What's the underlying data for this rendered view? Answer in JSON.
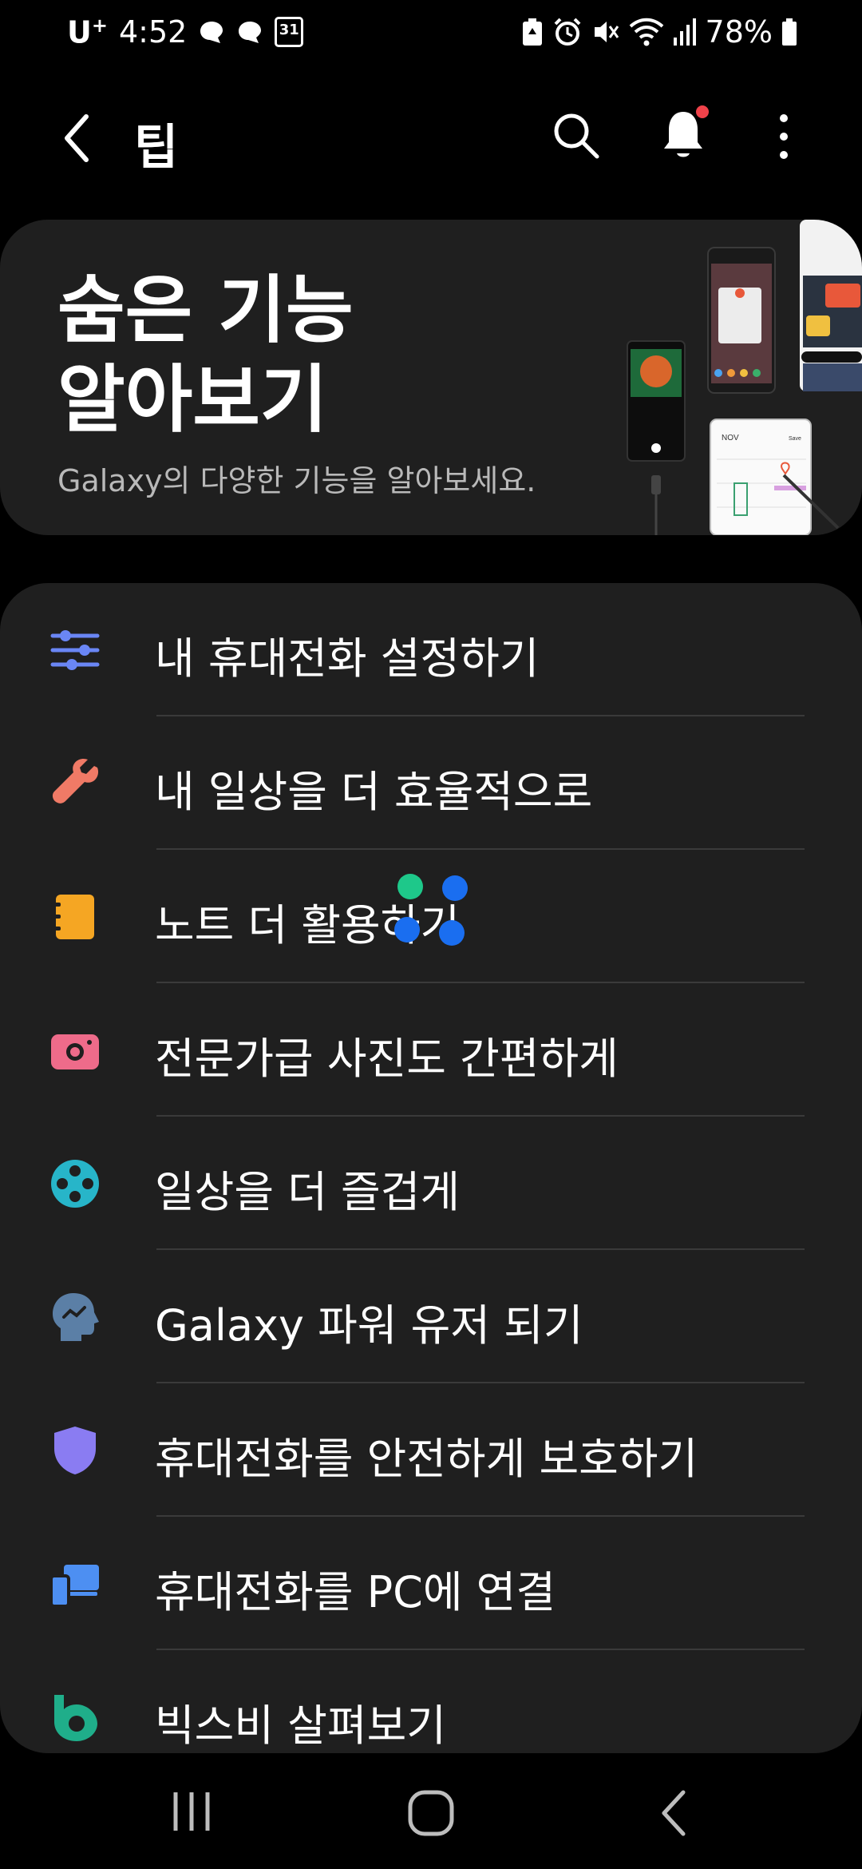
{
  "status_bar": {
    "carrier": "U",
    "carrier_sup": "+",
    "time": "4:52",
    "calendar_date": "31",
    "battery": "78%"
  },
  "app_bar": {
    "title": "팁"
  },
  "hero": {
    "title": "숨은 기능\n알아보기",
    "subtitle": "Galaxy의 다양한 기능을 알아보세요.",
    "art_month": "NOV",
    "art_save": "Save"
  },
  "list": {
    "items": [
      {
        "label": "내 휴대전화 설정하기",
        "icon": "sliders-icon",
        "color": "#6a86f5"
      },
      {
        "label": "내 일상을 더 효율적으로",
        "icon": "wrench-icon",
        "color": "#f07a66"
      },
      {
        "label": "노트 더 활용하기",
        "icon": "notebook-icon",
        "color": "#f5a623"
      },
      {
        "label": "전문가급 사진도 간편하게",
        "icon": "camera-icon",
        "color": "#ee6b8a"
      },
      {
        "label": "일상을 더 즐겁게",
        "icon": "film-reel-icon",
        "color": "#27b5c9"
      },
      {
        "label": "Galaxy 파워 유저 되기",
        "icon": "head-icon",
        "color": "#5b7fa6"
      },
      {
        "label": "휴대전화를 안전하게 보호하기",
        "icon": "shield-icon",
        "color": "#8a7cf2"
      },
      {
        "label": "휴대전화를 PC에 연결",
        "icon": "phone-pc-icon",
        "color": "#4d8ff2"
      },
      {
        "label": "빅스비 살펴보기",
        "icon": "bixby-icon",
        "color": "#1fae8a"
      }
    ]
  },
  "colors": {
    "background": "#000000",
    "card": "#1f1f1f",
    "notification_dot": "#f0424a"
  }
}
